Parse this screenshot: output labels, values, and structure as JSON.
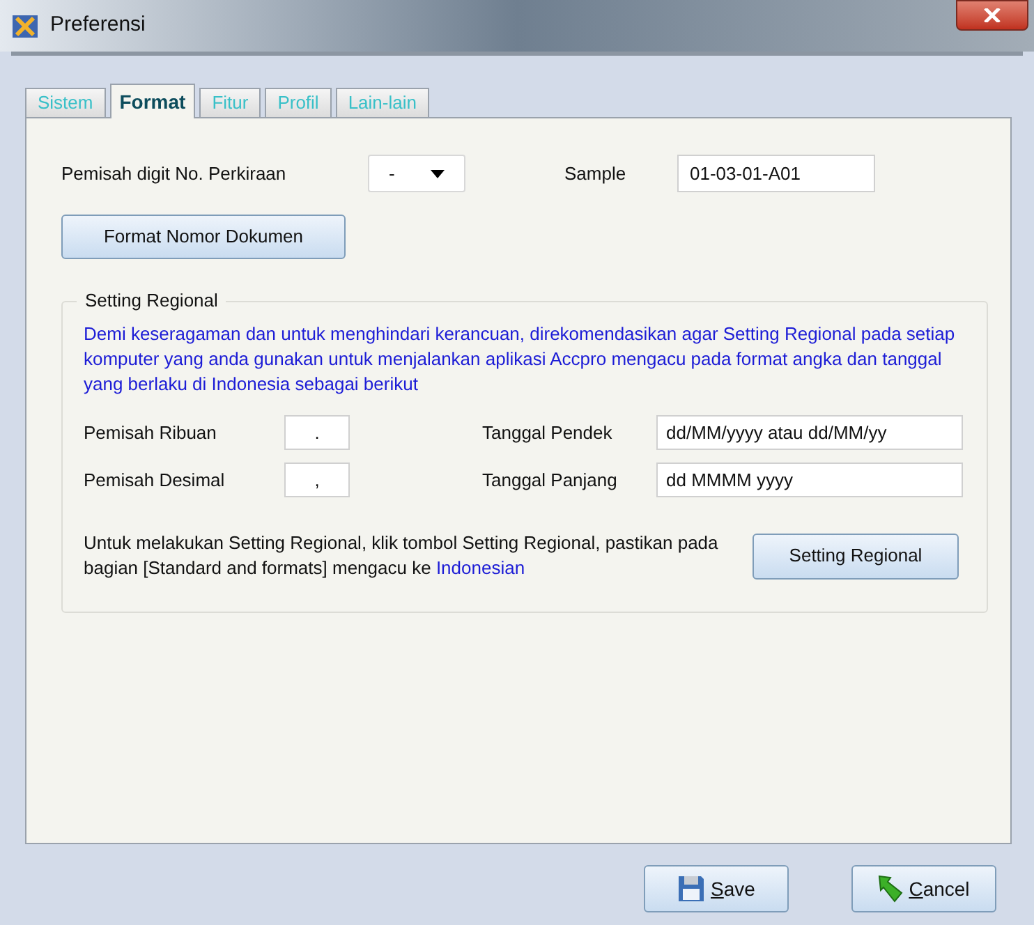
{
  "window": {
    "title": "Preferensi"
  },
  "tabs": [
    {
      "label": "Sistem",
      "selected": false
    },
    {
      "label": "Format",
      "selected": true
    },
    {
      "label": "Fitur",
      "selected": false
    },
    {
      "label": "Profil",
      "selected": false
    },
    {
      "label": "Lain-lain",
      "selected": false
    }
  ],
  "separator": {
    "label": "Pemisah digit No. Perkiraan",
    "value": "-"
  },
  "sample": {
    "label": "Sample",
    "value": "01-03-01-A01"
  },
  "format_button": "Format Nomor Dokumen",
  "regional": {
    "title": "Setting Regional",
    "info": "Demi keseragaman dan untuk menghindari kerancuan, direkomendasikan agar Setting Regional pada setiap komputer yang anda gunakan untuk menjalankan aplikasi Accpro mengacu pada format angka dan tanggal yang berlaku di Indonesia sebagai berikut",
    "fields": [
      {
        "label": "Pemisah Ribuan",
        "value": "."
      },
      {
        "label": "Pemisah Desimal",
        "value": ","
      }
    ],
    "dates": [
      {
        "label": "Tanggal Pendek",
        "value": "dd/MM/yyyy atau dd/MM/yy"
      },
      {
        "label": "Tanggal Panjang",
        "value": "dd MMMM yyyy"
      }
    ],
    "note": "Untuk melakukan Setting Regional, klik tombol Setting Regional, pastikan pada bagian [Standard and formats] mengacu ke",
    "note_highlight": "Indonesian",
    "button": "Setting Regional"
  },
  "buttons": [
    {
      "kind": "save",
      "label": "Save"
    },
    {
      "kind": "cancel",
      "label": "Cancel"
    }
  ]
}
